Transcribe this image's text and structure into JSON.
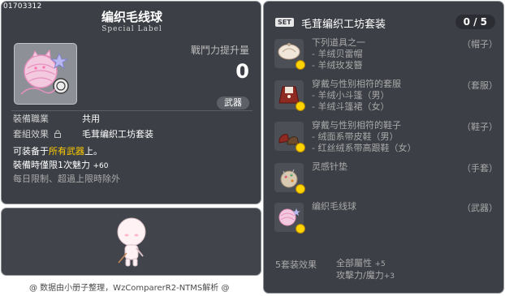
{
  "item": {
    "id": "01703312",
    "name": "编织毛线球",
    "label": "Special Label",
    "power_label": "戰鬥力提升量",
    "power_value": "0",
    "category": "武器",
    "job_label": "裝備職業",
    "job_value": "共用",
    "set_label": "套組效果",
    "set_value": "毛茸编织工坊套装",
    "desc_prefix": "可装备于",
    "desc_highlight": "所有武器",
    "desc_suffix": "上。",
    "effect_text": "裝備時僅限1次魅力",
    "effect_value": "+60",
    "limit_text": "每日限制、超過上限時除外"
  },
  "set": {
    "badge": "SET",
    "name": "毛茸编织工坊套装",
    "count": "0 / 5",
    "pieces": [
      {
        "lines": [
          "下列道具之一",
          "- 羊绒贝雷帽",
          "- 羊绒玫发簪"
        ],
        "slot": "（帽子）",
        "icon": "hat-icon"
      },
      {
        "lines": [
          "穿戴与性别相符的套服",
          "- 羊绒小斗篷（男）",
          "- 羊绒斗篷裙（女）"
        ],
        "slot": "（套服）",
        "icon": "overall-icon"
      },
      {
        "lines": [
          "穿戴与性别相符的鞋子",
          "- 绒面系带皮鞋（男）",
          "- 红丝绒系带高跟鞋（女）"
        ],
        "slot": "（鞋子）",
        "icon": "shoes-icon"
      },
      {
        "lines": [
          "灵感针垫"
        ],
        "slot": "（手套）",
        "icon": "pincushion-icon"
      },
      {
        "lines": [
          "编织毛线球"
        ],
        "slot": "（武器）",
        "icon": "yarn-ball-icon"
      }
    ],
    "effect_label": "5套装效果",
    "effects": [
      {
        "text": "全部屬性",
        "value": "+5"
      },
      {
        "text": "攻擊力/魔力",
        "value": "+3"
      }
    ]
  },
  "credit": "@ 数据由小册子整理，WzComparerR2-NTMS解析 @",
  "colors": {
    "panel": "#3c3f45",
    "border": "#8d9299",
    "highlight": "#ffcc00",
    "dim": "#a9a9a9"
  }
}
